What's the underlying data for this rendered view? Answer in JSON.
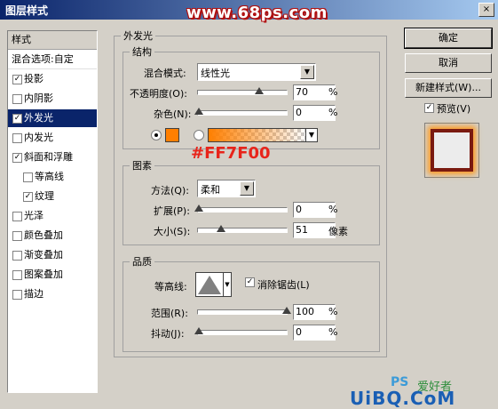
{
  "window": {
    "title": "图层样式",
    "close_glyph": "×"
  },
  "watermark_top": "www.68ps.com",
  "left_panel": {
    "header": "样式",
    "blend_options": "混合选项:自定",
    "items": [
      {
        "label": "投影",
        "checked": true
      },
      {
        "label": "内阴影",
        "checked": false
      },
      {
        "label": "外发光",
        "checked": true,
        "selected": true
      },
      {
        "label": "内发光",
        "checked": false
      },
      {
        "label": "斜面和浮雕",
        "checked": true
      },
      {
        "label": "等高线",
        "checked": false,
        "sub": true
      },
      {
        "label": "纹理",
        "checked": true,
        "sub": true
      },
      {
        "label": "光泽",
        "checked": false
      },
      {
        "label": "颜色叠加",
        "checked": false
      },
      {
        "label": "渐变叠加",
        "checked": false
      },
      {
        "label": "图案叠加",
        "checked": false
      },
      {
        "label": "描边",
        "checked": false
      }
    ]
  },
  "outer_glow": {
    "title": "外发光",
    "structure": {
      "title": "结构",
      "blend_mode_label": "混合模式:",
      "blend_mode_value": "线性光",
      "opacity_label": "不透明度(O):",
      "opacity_value": "70",
      "opacity_unit": "%",
      "noise_label": "杂色(N):",
      "noise_value": "0",
      "noise_unit": "%",
      "color": "#ff7f00"
    },
    "elements": {
      "title": "图素",
      "technique_label": "方法(Q):",
      "technique_value": "柔和",
      "spread_label": "扩展(P):",
      "spread_value": "0",
      "spread_unit": "%",
      "size_label": "大小(S):",
      "size_value": "51",
      "size_unit": "像素"
    },
    "quality": {
      "title": "品质",
      "contour_label": "等高线:",
      "antialias_label": "消除锯齿(L)",
      "antialias_checked": true,
      "range_label": "范围(R):",
      "range_value": "100",
      "range_unit": "%",
      "jitter_label": "抖动(J):",
      "jitter_value": "0",
      "jitter_unit": "%"
    }
  },
  "annotation": "#FF7F00",
  "buttons": {
    "ok": "确定",
    "cancel": "取消",
    "new_style": "新建样式(W)...",
    "preview": "预览(V)",
    "preview_checked": true
  },
  "bottom_watermark": {
    "ps": "PS",
    "cn": "爱好者",
    "site": "UiBQ.CoM"
  }
}
